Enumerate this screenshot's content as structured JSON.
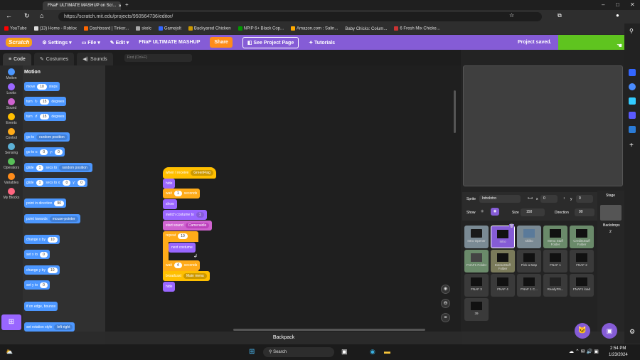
{
  "browser": {
    "tab_title": "FNaF ULTIMATE MASHUP on Scr...",
    "url": "https://scratch.mit.edu/projects/950564736/editor/",
    "bookmarks": [
      "YouTube",
      "(13) Home - Roblox",
      "Dashboard | Tinker...",
      "skelc",
      "Gamejolt",
      "Backyared Chicken",
      "NPIP 6+ Black Cop...",
      "Amazon.com : Salin...",
      "Baby Chicks: Colum...",
      "6 Fresh Mix Chicke..."
    ]
  },
  "menubar": {
    "logo": "Scratch",
    "settings": "Settings",
    "file": "File",
    "edit": "Edit",
    "project_title": "FNaF ULTIMATE MASHUP",
    "share": "Share",
    "see_project": "See Project Page",
    "tutorials": "Tutorials",
    "status": "Project saved."
  },
  "editor_tabs": {
    "code": "Code",
    "costumes": "Costumes",
    "sounds": "Sounds",
    "find_placeholder": "Find (Ctrl+F)"
  },
  "categories": [
    "Motion",
    "Looks",
    "Sound",
    "Events",
    "Control",
    "Sensing",
    "Operators",
    "Variables",
    "My Blocks"
  ],
  "palette": {
    "heading": "Motion",
    "blocks": {
      "move": [
        "move",
        "10",
        "steps"
      ],
      "turn_r": [
        "turn",
        "15",
        "degrees"
      ],
      "turn_l": [
        "turn",
        "15",
        "degrees"
      ],
      "goto": [
        "go to",
        "random position"
      ],
      "gotoxy": [
        "go to x:",
        "0",
        "y:",
        "0"
      ],
      "glide_to": [
        "glide",
        "1",
        "secs to",
        "random position"
      ],
      "glide_xy": [
        "glide",
        "1",
        "secs to x:",
        "0",
        "y:",
        "0"
      ],
      "point_dir": [
        "point in direction",
        "90"
      ],
      "point_toward": [
        "point towards",
        "mouse-pointer"
      ],
      "change_x": [
        "change x by",
        "10"
      ],
      "set_x": [
        "set x to",
        "0"
      ],
      "change_y": [
        "change y by",
        "10"
      ],
      "set_y": [
        "set y to",
        "0"
      ],
      "bounce": "if on edge, bounce",
      "rot_style": [
        "set rotation style",
        "left-right"
      ]
    }
  },
  "script": {
    "hat": [
      "when I receive",
      "GreenFlag"
    ],
    "hide1": "hide",
    "wait1": [
      "wait",
      "1",
      "seconds"
    ],
    "show": "show",
    "costume": [
      "switch costume to",
      "1"
    ],
    "sound": [
      "start sound",
      "Cameraidle"
    ],
    "repeat": [
      "repeat",
      "10"
    ],
    "next": "next costume",
    "wait2": [
      "wait",
      "4",
      "seconds"
    ],
    "broadcast": [
      "broadcast",
      "Main menu"
    ],
    "hide2": "hide"
  },
  "sprite_info": {
    "sprite_label": "Sprite",
    "sprite_name": "IntroIntro",
    "x_label": "x",
    "x": "0",
    "y_label": "y",
    "y": "0",
    "show_label": "Show",
    "size_label": "Size",
    "size": "150",
    "direction_label": "Direction",
    "direction": "90"
  },
  "stage_panel": {
    "label": "Stage",
    "backdrops_label": "Backdrops",
    "backdrops_count": "2"
  },
  "sprites": [
    {
      "name": "Intro Opener",
      "type": "folder"
    },
    {
      "name": "Intro",
      "type": "selected"
    },
    {
      "name": "skiiko",
      "type": "folder"
    },
    {
      "name": "Menu Stuff Folder",
      "type": "folder"
    },
    {
      "name": "CreditsStuff Folder",
      "type": "folder"
    },
    {
      "name": "FNAF1 Folder",
      "type": "folder"
    },
    {
      "name": "ExtrasStuff Folder",
      "type": "folder"
    },
    {
      "name": "Pick a Map",
      "type": "sprite"
    },
    {
      "name": "FNAF 1",
      "type": "sprite"
    },
    {
      "name": "FNAF 2",
      "type": "sprite"
    },
    {
      "name": "FNAF 3",
      "type": "sprite"
    },
    {
      "name": "FNAF 4",
      "type": "sprite"
    },
    {
      "name": "FNAF 1 C...",
      "type": "sprite"
    },
    {
      "name": "ReadyFN...",
      "type": "sprite"
    },
    {
      "name": "FNAF1 load",
      "type": "sprite"
    },
    {
      "name": "39",
      "type": "sprite"
    }
  ],
  "backpack": "Backpack",
  "taskbar": {
    "search": "Search",
    "time": "2:54 PM",
    "date": "1/23/2024"
  },
  "colors": {
    "motion": "#4c97ff",
    "looks": "#9966ff",
    "sound": "#cf63cf",
    "events": "#ffbf00",
    "control": "#ffab19",
    "sensing": "#5cb1d6",
    "operators": "#59c059",
    "variables": "#ff8c1a",
    "myblocks": "#ff6680",
    "scratch": "#855cd6",
    "green": "#5fc41f"
  }
}
